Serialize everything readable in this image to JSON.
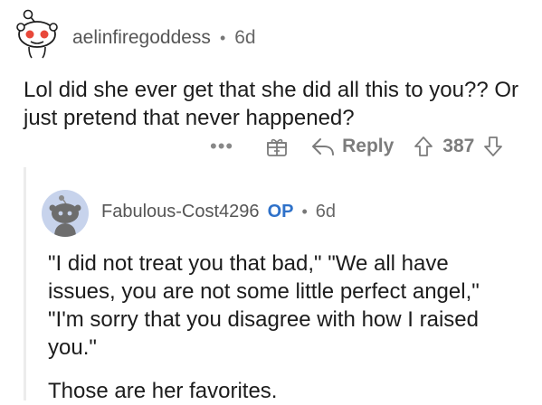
{
  "parent": {
    "author": "aelinfiregoddess",
    "separator": "•",
    "age": "6d",
    "text": "Lol did she ever get that she did all this to you?? Or just pretend that never happened?",
    "actions": {
      "more": "•••",
      "reply_label": "Reply",
      "score": "387"
    }
  },
  "reply": {
    "author": "Fabulous-Cost4296",
    "badge": "OP",
    "separator": "•",
    "age": "6d",
    "paragraphs": [
      "\"I did not treat you that bad,\" \"We all have issues, you are not some little perfect angel,\" \"I'm sorry that you disagree with how I raised you.\"",
      "Those are her favorites."
    ]
  },
  "colors": {
    "op_badge": "#2e71c9",
    "snoo_red": "#e8483a",
    "avatar_bg": "#c7d3ec",
    "thread_line": "#ececec"
  },
  "icons": [
    "snoo-avatar-icon",
    "gift-award-icon",
    "reply-arrow-icon",
    "upvote-icon",
    "downvote-icon"
  ]
}
